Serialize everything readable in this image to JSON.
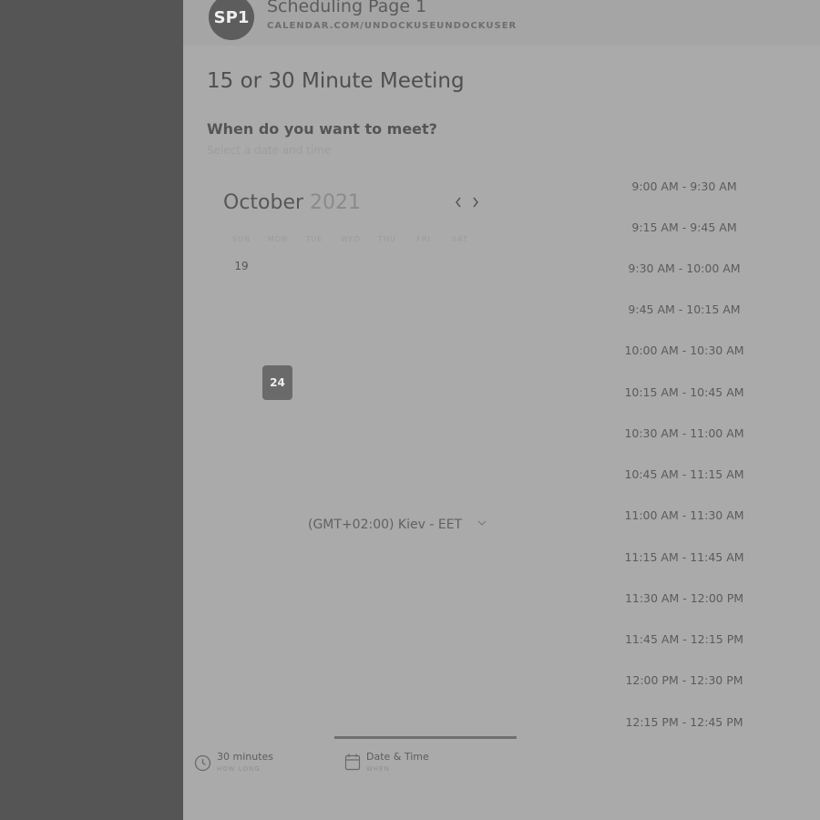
{
  "header": {
    "avatar_text": "SP1",
    "page_name": "Scheduling Page 1",
    "page_url": "CALENDAR.COM/UNDOCKUSEUNDOCKUSER"
  },
  "meeting": {
    "title": "15 or 30 Minute Meeting",
    "question": "When do you want to meet?",
    "subtext": "Select a date and time"
  },
  "calendar": {
    "month": "October",
    "year": "2021",
    "prev_icon": "chevron-left-icon",
    "next_icon": "chevron-right-icon",
    "weekdays": [
      "SUN",
      "MON",
      "TUE",
      "WED",
      "THU",
      "FRI",
      "SAT"
    ],
    "active_day": "19",
    "selected_day": "24"
  },
  "timezone": {
    "label": "(GMT+02:00) Kiev - EET",
    "icon": "chevron-down-icon"
  },
  "time_slots": [
    "9:00 AM - 9:30 AM",
    "9:15 AM - 9:45 AM",
    "9:30 AM - 10:00 AM",
    "9:45 AM - 10:15 AM",
    "10:00 AM - 10:30 AM",
    "10:15 AM - 10:45 AM",
    "10:30 AM - 11:00 AM",
    "10:45 AM - 11:15 AM",
    "11:00 AM - 11:30 AM",
    "11:15 AM - 11:45 AM",
    "11:30 AM - 12:00 PM",
    "11:45 AM - 12:15 PM",
    "12:00 PM - 12:30 PM",
    "12:15 PM - 12:45 PM"
  ],
  "steps": {
    "duration": {
      "label": "30 minutes",
      "sub": "HOW LONG",
      "icon": "clock-icon"
    },
    "datetime": {
      "label": "Date & Time",
      "sub": "WHEN",
      "icon": "calendar-icon"
    }
  }
}
